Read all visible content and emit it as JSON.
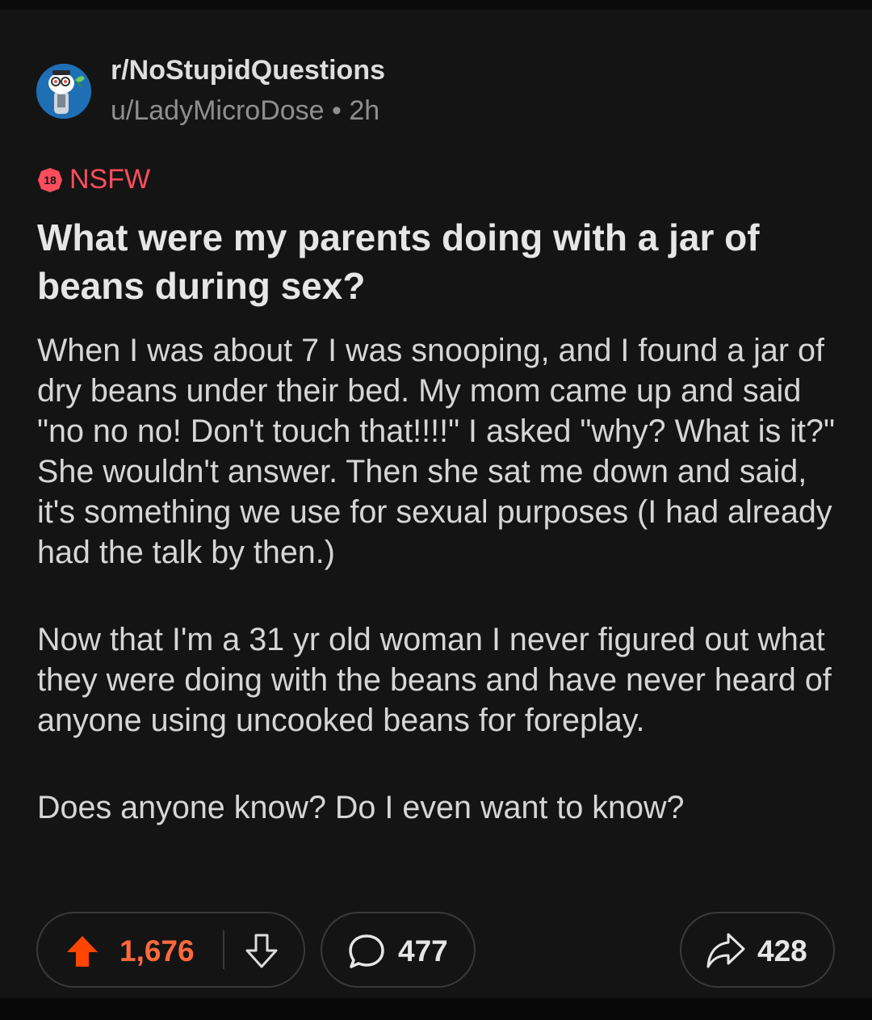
{
  "post": {
    "subreddit": "r/NoStupidQuestions",
    "author": "u/LadyMicroDose",
    "separator": "•",
    "age": "2h",
    "nsfw_badge": "18",
    "nsfw_label": "NSFW",
    "title": "What were my parents doing with a jar of beans during sex?",
    "body": [
      "When I was about 7 I was snooping, and I found a jar of dry beans under their bed. My mom came up and said \"no no no! Don't touch that!!!!\" I asked \"why? What is it?\" She wouldn't answer. Then she sat me down and said, it's something we use for sexual purposes (I had already had the talk by then.)",
      "Now that I'm a 31 yr old woman I never figured out what they were doing with the beans and have never heard of anyone using uncooked beans for foreplay.",
      "Does anyone know? Do I even want to know?"
    ]
  },
  "actions": {
    "upvotes": "1,676",
    "comments": "477",
    "shares": "428"
  },
  "icons": {
    "upvote": "upvote-arrow-icon",
    "downvote": "downvote-arrow-icon",
    "comment": "comment-bubble-icon",
    "share": "share-arrow-icon",
    "avatar": "snoo-avatar-icon"
  },
  "colors": {
    "background": "#141414",
    "nsfw": "#ff4d5e",
    "upvote_active": "#ff4500",
    "vote_count": "#ff6a3d",
    "avatar_bg": "#1f6fb5"
  }
}
